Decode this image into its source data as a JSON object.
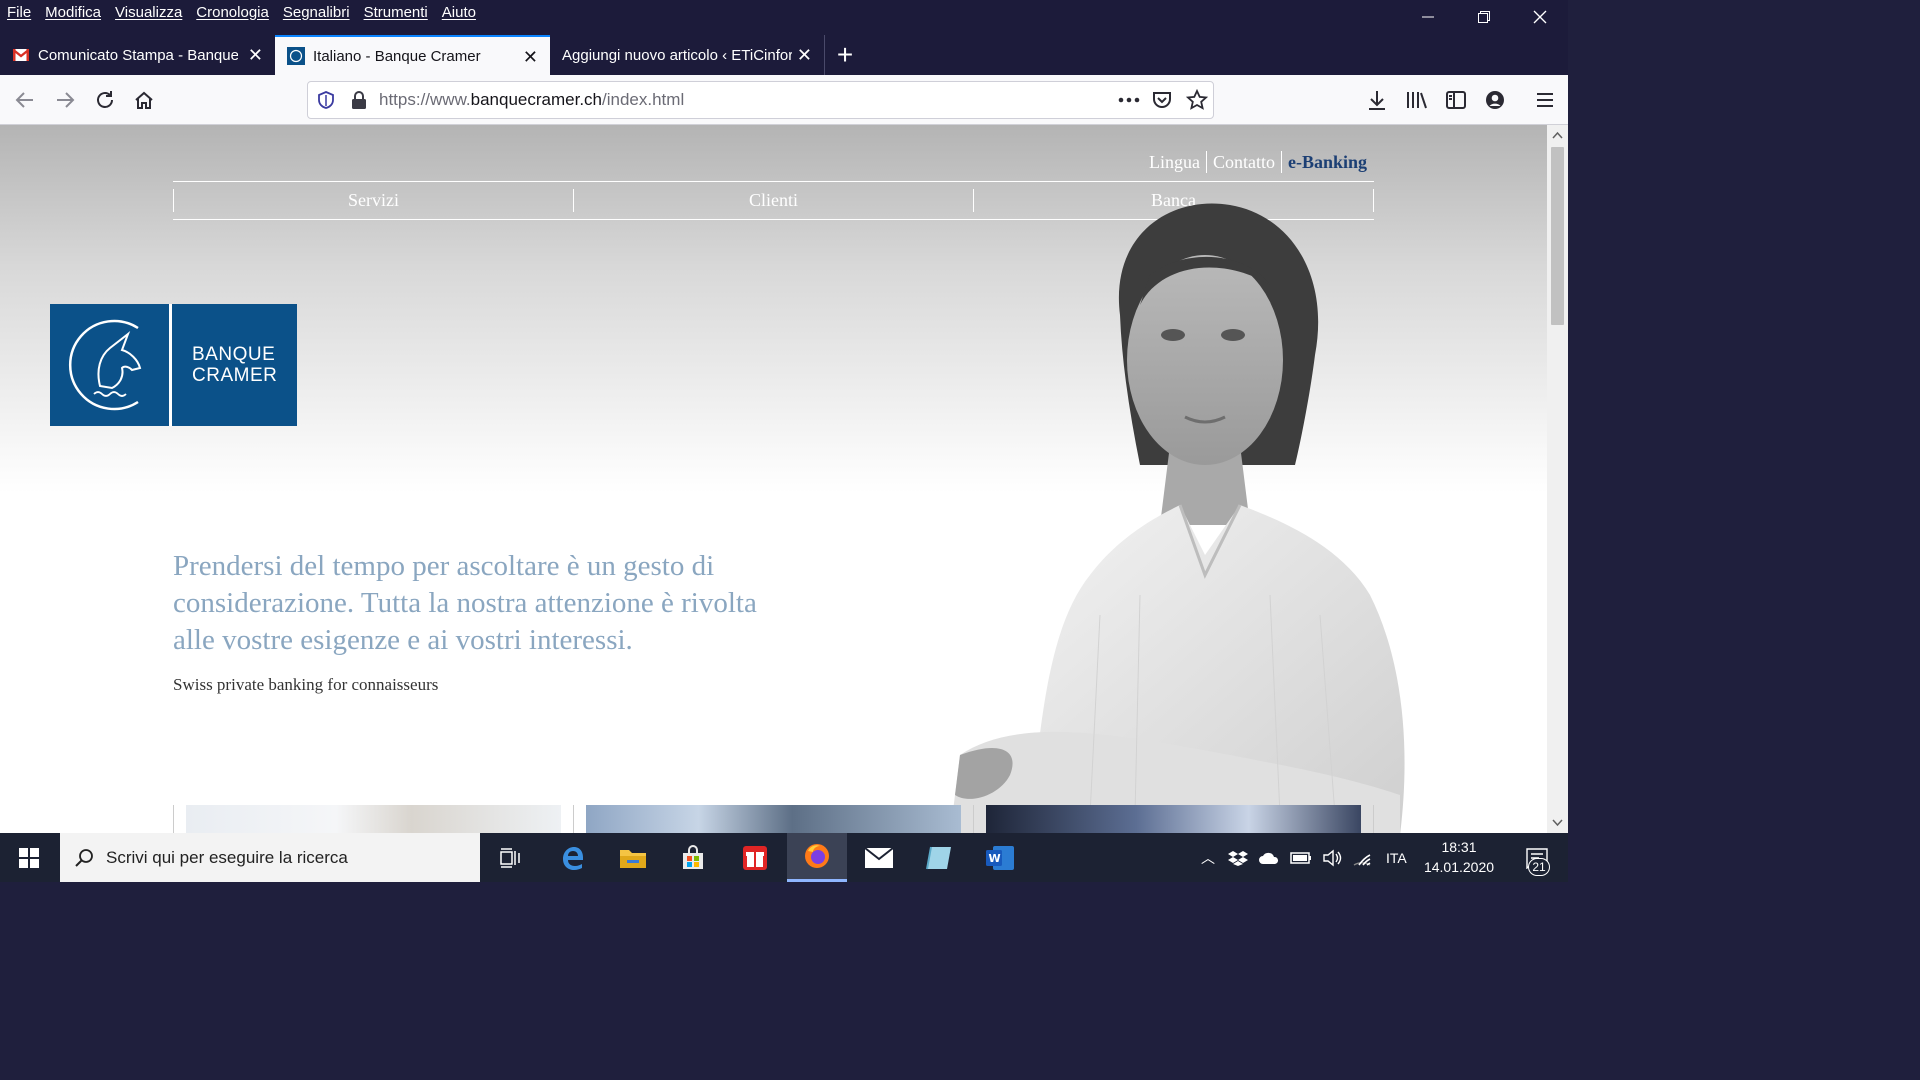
{
  "menubar": [
    "File",
    "Modifica",
    "Visualizza",
    "Cronologia",
    "Segnalibri",
    "Strumenti",
    "Aiuto"
  ],
  "tabs": [
    {
      "title": "Comunicato Stampa - Banque C"
    },
    {
      "title": "Italiano - Banque Cramer"
    },
    {
      "title": "Aggiungi nuovo articolo ‹ ETiCinfor"
    }
  ],
  "url": {
    "prefix": "https://www.",
    "domain": "banquecramer.ch",
    "path": "/index.html"
  },
  "site": {
    "toplinks": [
      "Lingua",
      "Contatto",
      "e-Banking"
    ],
    "nav": [
      "Servizi",
      "Clienti",
      "Banca"
    ],
    "logo": {
      "line1": "BANQUE",
      "line2": "CRAMER"
    },
    "headline": "Prendersi del tempo per ascoltare è un gesto di considerazione. Tutta la nostra attenzione è rivolta alle vostre esigenze e ai vostri interessi.",
    "subtitle": "Swiss private banking for connaisseurs"
  },
  "taskbar": {
    "search_placeholder": "Scrivi qui per eseguire la ricerca",
    "language": "ITA",
    "time": "18:31",
    "date": "14.01.2020",
    "notifications": "21"
  }
}
